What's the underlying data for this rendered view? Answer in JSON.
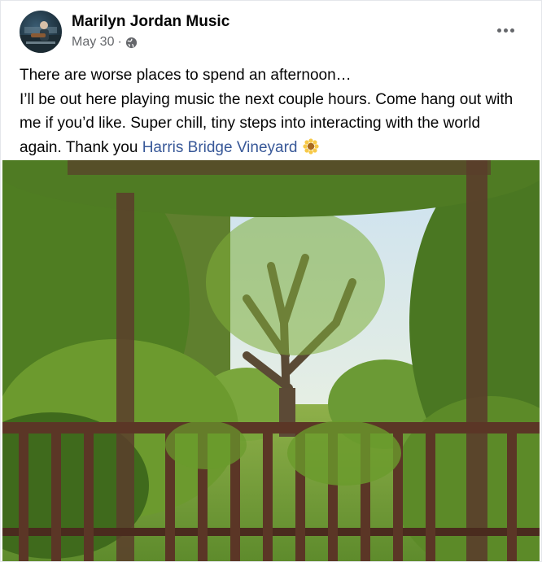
{
  "post": {
    "author": "Marilyn Jordan Music",
    "date": "May 30",
    "separator": "·",
    "privacy_icon": "globe-icon",
    "more_icon": "more-options-icon",
    "text_line1": "There are worse places to spend an afternoon…",
    "text_line2_prefix": "I’ll be out here playing music the next couple hours. Come hang out with me if you’d like. Super chill, tiny steps into interacting with the world again. Thank you ",
    "tag_link": "Harris Bridge Vineyard",
    "emoji_icon": "sunflower-icon"
  },
  "colors": {
    "text": "#050505",
    "secondary": "#65676b",
    "link": "#385898"
  }
}
